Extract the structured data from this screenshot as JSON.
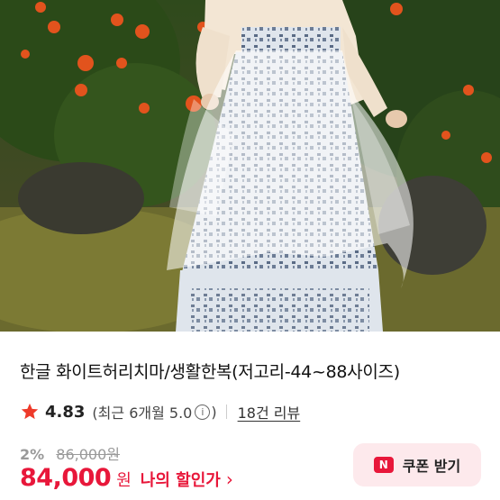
{
  "product": {
    "title": "한글 화이트허리치마/생활한복(저고리-44~88사이즈)",
    "image_alt": "product-photo"
  },
  "rating": {
    "score": "4.83",
    "recent_prefix": "(최근 6개월 5.0",
    "recent_suffix": ")",
    "info_glyph": "i",
    "review_count": "18건 리뷰"
  },
  "price": {
    "discount_rate": "2%",
    "original": "86,000원",
    "current": "84,000",
    "currency": "원",
    "my_discount": "나의 할인가",
    "chevron": "›"
  },
  "coupon": {
    "logo": "N",
    "label": "쿠폰 받기"
  },
  "colors": {
    "accent": "#e8173a",
    "coupon_bg": "#fde9ec"
  }
}
